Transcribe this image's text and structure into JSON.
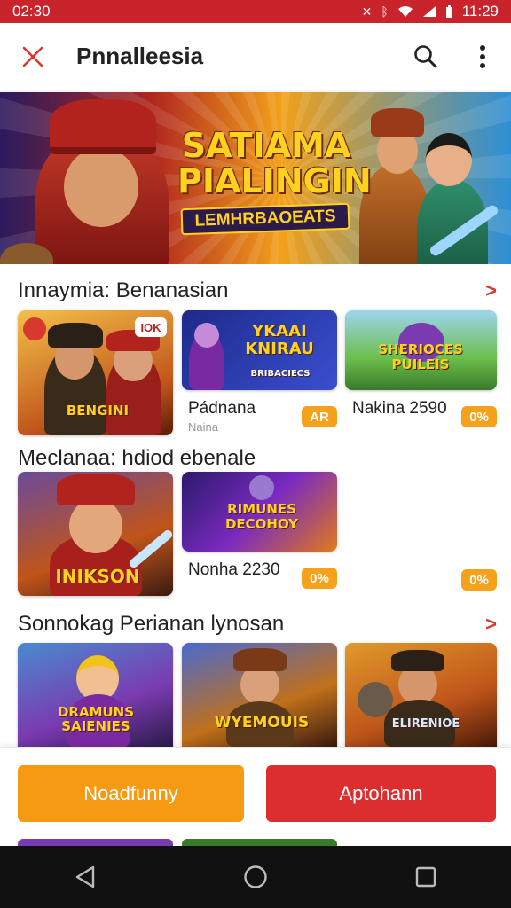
{
  "status": {
    "time": "02:30",
    "clock_right": "11:29"
  },
  "appbar": {
    "title": "Pnnalleesia",
    "close_icon": "close-icon",
    "search_icon": "search-icon",
    "menu_icon": "more-vert-icon"
  },
  "banner": {
    "title_line1": "SATIAMA",
    "title_line2": "PIALINGIN",
    "subtitle": "LEMHRBAOEATS"
  },
  "sections": [
    {
      "title": "Innaymia: Benanasian",
      "tiles": [
        {
          "art_label": "BENGINI",
          "corner_badge": "IOK"
        },
        {
          "art_label": "YKAAI KNIRAU",
          "art_sub": "BRIBACIECS",
          "name": "Pádnana",
          "sub": "Naina",
          "badge": "AR"
        },
        {
          "art_label": "SHERIOCES PUILEIS",
          "name": "Nakina 2590",
          "badge": "0%"
        }
      ]
    },
    {
      "title": "Meclanaa: hdiod ebenale",
      "tiles": [
        {
          "art_label": "INIKSON"
        },
        {
          "art_label": "RIMUNES DECOHOY",
          "name": "Nonha 2230",
          "badge": "0%"
        }
      ],
      "extra_badge": "0%"
    },
    {
      "title": "Sonnokag Perianan lynosan",
      "tiles": [
        {
          "art_label": "DRAMUNS SAIENIES"
        },
        {
          "art_label": "WYEMOUIS"
        },
        {
          "art_label": "ELIRENIOE"
        }
      ]
    }
  ],
  "actions": {
    "primary": "Noadfunny",
    "secondary": "Aptohann"
  },
  "navbar": {
    "back_icon": "back-triangle-icon",
    "home_icon": "home-circle-icon",
    "recents_icon": "recents-square-icon"
  },
  "colors": {
    "accent_red": "#dc2e2e",
    "accent_orange": "#f59a12",
    "status_bar": "#c9242b"
  }
}
